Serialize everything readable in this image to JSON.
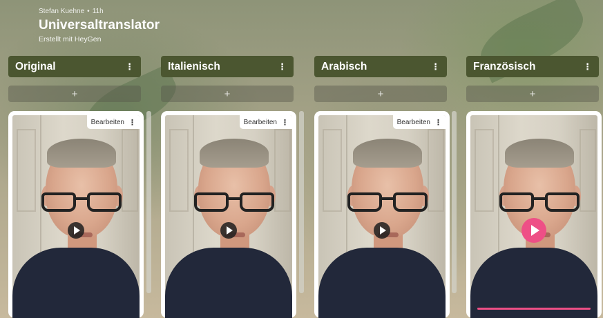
{
  "post": {
    "author": "Stefan Kuehne",
    "separator": "•",
    "age": "11h",
    "title": "Universaltranslator",
    "subtitle": "Erstellt mit HeyGen"
  },
  "columns": [
    {
      "title": "Original",
      "menu": "⋮",
      "add": "+",
      "edit": "Bearbeiten",
      "card_menu": "⋮",
      "playing": false
    },
    {
      "title": "Italienisch",
      "menu": "⋮",
      "add": "+",
      "edit": "Bearbeiten",
      "card_menu": "⋮",
      "playing": false
    },
    {
      "title": "Arabisch",
      "menu": "⋮",
      "add": "+",
      "edit": "Bearbeiten",
      "card_menu": "⋮",
      "playing": false
    },
    {
      "title": "Französisch",
      "menu": "⋮",
      "add": "+",
      "playing": true
    }
  ],
  "colors": {
    "column_header": "#4b5630",
    "accent_play": "#ee4f86"
  }
}
